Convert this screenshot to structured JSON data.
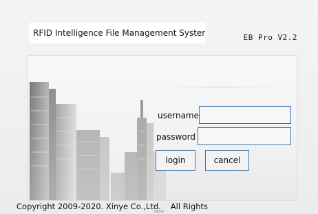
{
  "app": {
    "title": "RFID Intelligence File Management System",
    "version": "EB Pro V2.2"
  },
  "login_form": {
    "username_label": "username",
    "username_value": "",
    "password_label": "password",
    "password_value": "",
    "login_label": "login",
    "cancel_label": "cancel"
  },
  "footer": {
    "copyright": "Copyright 2009-2020. Xinye Co.,Ltd.",
    "rights": "All Rights"
  },
  "colors": {
    "field_border": "#3a6ea8",
    "panel_background": "#f4f4f4"
  },
  "icons": {
    "background_image": "city-skyline"
  }
}
